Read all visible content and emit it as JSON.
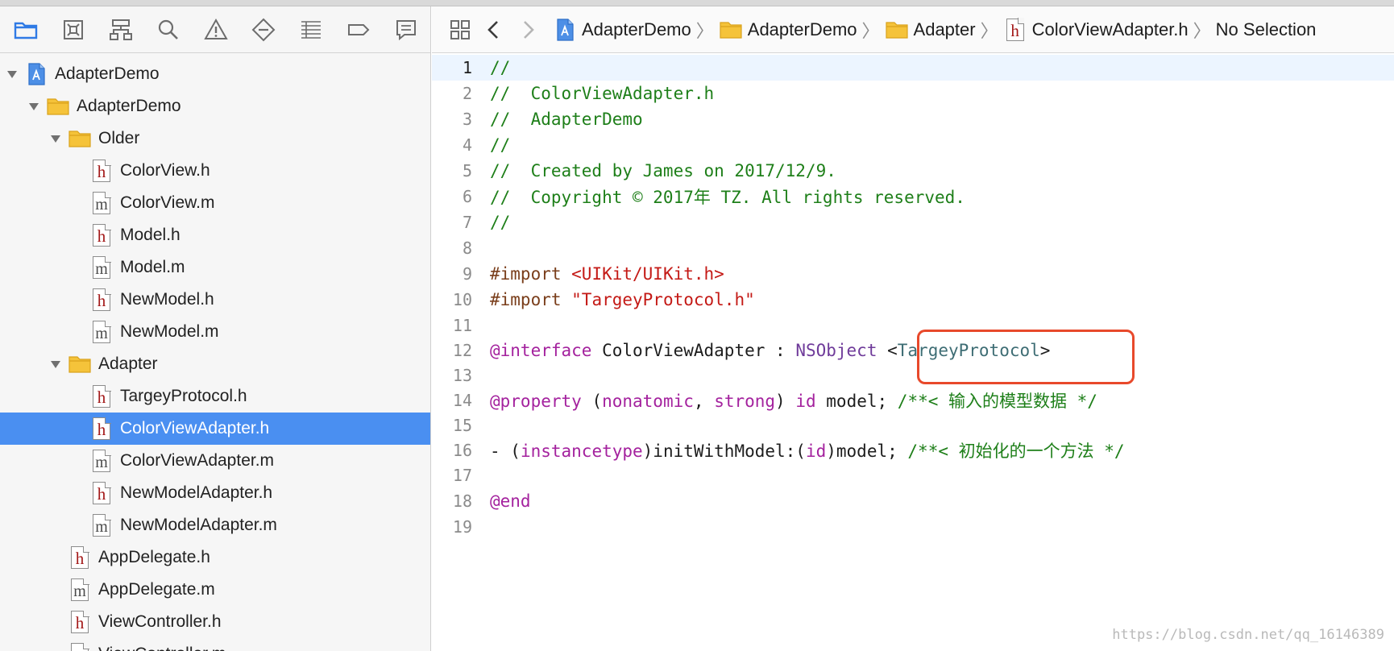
{
  "navigator_toolbar": {
    "icons": [
      "folder-icon",
      "source-control-icon",
      "hierarchy-icon",
      "search-icon",
      "warning-icon",
      "test-icon",
      "debug-icon",
      "breakpoint-icon",
      "report-icon"
    ]
  },
  "tree": [
    {
      "label": "AdapterDemo",
      "kind": "project",
      "depth": 0,
      "expanded": true
    },
    {
      "label": "AdapterDemo",
      "kind": "folder",
      "depth": 1,
      "expanded": true
    },
    {
      "label": "Older",
      "kind": "folder",
      "depth": 2,
      "expanded": true
    },
    {
      "label": "ColorView.h",
      "kind": "h",
      "depth": 3
    },
    {
      "label": "ColorView.m",
      "kind": "m",
      "depth": 3
    },
    {
      "label": "Model.h",
      "kind": "h",
      "depth": 3
    },
    {
      "label": "Model.m",
      "kind": "m",
      "depth": 3
    },
    {
      "label": "NewModel.h",
      "kind": "h",
      "depth": 3
    },
    {
      "label": "NewModel.m",
      "kind": "m",
      "depth": 3
    },
    {
      "label": "Adapter",
      "kind": "folder",
      "depth": 2,
      "expanded": true
    },
    {
      "label": "TargeyProtocol.h",
      "kind": "h",
      "depth": 3
    },
    {
      "label": "ColorViewAdapter.h",
      "kind": "h",
      "depth": 3,
      "selected": true
    },
    {
      "label": "ColorViewAdapter.m",
      "kind": "m",
      "depth": 3
    },
    {
      "label": "NewModelAdapter.h",
      "kind": "h",
      "depth": 3
    },
    {
      "label": "NewModelAdapter.m",
      "kind": "m",
      "depth": 3
    },
    {
      "label": "AppDelegate.h",
      "kind": "h",
      "depth": 2
    },
    {
      "label": "AppDelegate.m",
      "kind": "m",
      "depth": 2
    },
    {
      "label": "ViewController.h",
      "kind": "h",
      "depth": 2
    },
    {
      "label": "ViewController.m",
      "kind": "m",
      "depth": 2
    }
  ],
  "jumpbar": {
    "crumbs": [
      {
        "label": "AdapterDemo",
        "kind": "project"
      },
      {
        "label": "AdapterDemo",
        "kind": "folder"
      },
      {
        "label": "Adapter",
        "kind": "folder"
      },
      {
        "label": "ColorViewAdapter.h",
        "kind": "h"
      },
      {
        "label": "No Selection",
        "kind": "none"
      }
    ]
  },
  "editor": {
    "current_line": 1,
    "lines": [
      [
        {
          "t": "//",
          "c": "comment"
        }
      ],
      [
        {
          "t": "//  ColorViewAdapter.h",
          "c": "comment"
        }
      ],
      [
        {
          "t": "//  AdapterDemo",
          "c": "comment"
        }
      ],
      [
        {
          "t": "//",
          "c": "comment"
        }
      ],
      [
        {
          "t": "//  Created by James on 2017/12/9.",
          "c": "comment"
        }
      ],
      [
        {
          "t": "//  Copyright © 2017年 TZ. All rights reserved.",
          "c": "comment"
        }
      ],
      [
        {
          "t": "//",
          "c": "comment"
        }
      ],
      [],
      [
        {
          "t": "#import ",
          "c": "pre"
        },
        {
          "t": "<UIKit/UIKit.h>",
          "c": "string"
        }
      ],
      [
        {
          "t": "#import ",
          "c": "pre"
        },
        {
          "t": "\"TargeyProtocol.h\"",
          "c": "string"
        }
      ],
      [],
      [
        {
          "t": "@interface",
          "c": "kw"
        },
        {
          "t": " ColorViewAdapter : ",
          "c": "plain"
        },
        {
          "t": "NSObject",
          "c": "type"
        },
        {
          "t": " <",
          "c": "plain"
        },
        {
          "t": "TargeyProtocol",
          "c": "proto"
        },
        {
          "t": ">",
          "c": "plain"
        }
      ],
      [],
      [
        {
          "t": "@property",
          "c": "kw"
        },
        {
          "t": " (",
          "c": "plain"
        },
        {
          "t": "nonatomic",
          "c": "kw"
        },
        {
          "t": ", ",
          "c": "plain"
        },
        {
          "t": "strong",
          "c": "kw"
        },
        {
          "t": ") ",
          "c": "plain"
        },
        {
          "t": "id",
          "c": "kw"
        },
        {
          "t": " model; ",
          "c": "plain"
        },
        {
          "t": "/**< 输入的模型数据 */",
          "c": "comment"
        }
      ],
      [],
      [
        {
          "t": "- (",
          "c": "plain"
        },
        {
          "t": "instancetype",
          "c": "kw"
        },
        {
          "t": ")initWithModel:(",
          "c": "plain"
        },
        {
          "t": "id",
          "c": "kw"
        },
        {
          "t": ")model; ",
          "c": "plain"
        },
        {
          "t": "/**< 初始化的一个方法 */",
          "c": "comment"
        }
      ],
      [],
      [
        {
          "t": "@end",
          "c": "kw"
        }
      ],
      []
    ]
  },
  "watermark": "https://blog.csdn.net/qq_16146389",
  "colors": {
    "selection": "#4a8ff1",
    "highlight_box": "#e8492b",
    "comment": "#1e7f19",
    "keyword": "#a4229e"
  }
}
